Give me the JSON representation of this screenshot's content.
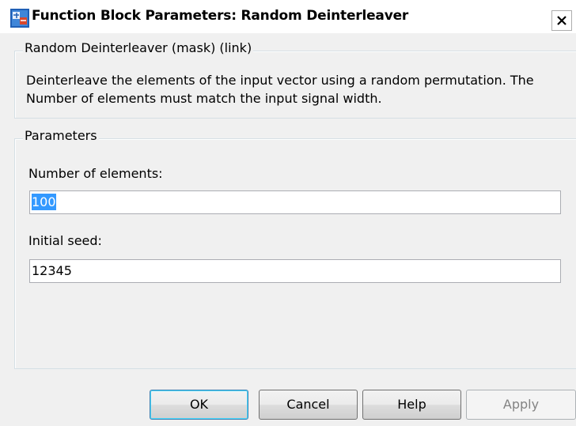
{
  "window": {
    "title": "Function Block Parameters: Random Deinterleaver",
    "icon": "simulink-block-icon",
    "close_icon": "close-icon"
  },
  "description_group": {
    "legend": "Random Deinterleaver (mask) (link)",
    "text": "Deinterleave the elements of the input vector using a random permutation.  The Number of elements must match the input signal width."
  },
  "parameters_group": {
    "legend": "Parameters",
    "fields": [
      {
        "label": "Number of elements:",
        "value": "100",
        "selected": true
      },
      {
        "label": "Initial seed:",
        "value": "12345",
        "selected": false
      }
    ]
  },
  "buttons": {
    "ok": "OK",
    "cancel": "Cancel",
    "help": "Help",
    "apply": "Apply",
    "apply_enabled": false
  },
  "colors": {
    "selection": "#3399ff",
    "default_button_border": "#3c7fb1",
    "disabled_text": "#838383"
  }
}
